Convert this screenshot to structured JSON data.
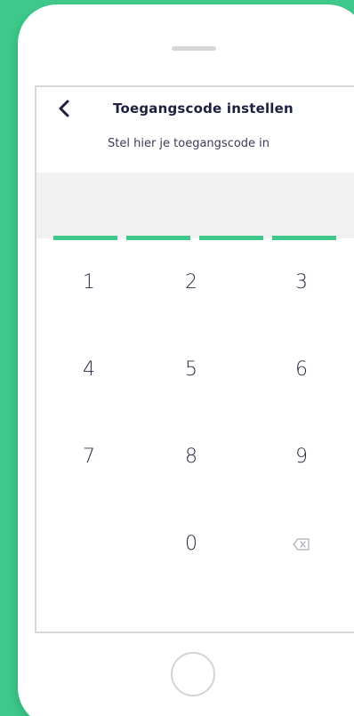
{
  "header": {
    "title": "Toegangscode instellen",
    "subtitle": "Stel hier je toegangscode in"
  },
  "passcode": {
    "length": 4,
    "entered": 0
  },
  "keypad": {
    "keys": [
      "1",
      "2",
      "3",
      "4",
      "5",
      "6",
      "7",
      "8",
      "9",
      "0"
    ]
  },
  "icons": {
    "back": "chevron-left-icon",
    "backspace": "backspace-icon",
    "home": "home-button"
  },
  "colors": {
    "accent": "#3ec98a",
    "text": "#1f2040",
    "code_area": "#f1f1f1"
  }
}
